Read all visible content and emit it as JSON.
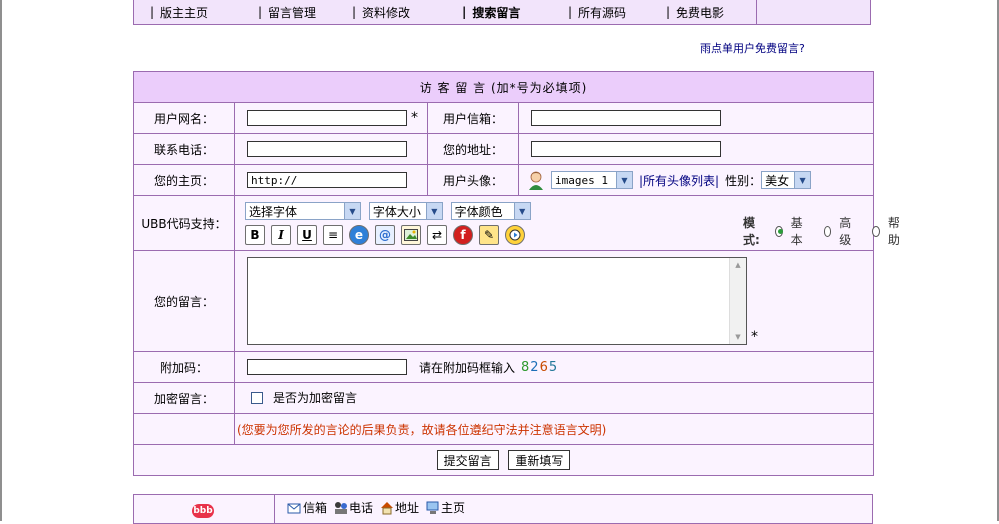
{
  "nav": {
    "items": [
      {
        "label": "版主主页",
        "bold": false
      },
      {
        "label": "留言管理",
        "bold": false
      },
      {
        "label": "资料修改",
        "bold": false
      },
      {
        "label": "搜索留言",
        "bold": true
      },
      {
        "label": "所有源码",
        "bold": false
      },
      {
        "label": "免费电影",
        "bold": false
      }
    ],
    "separator": "|"
  },
  "free_link": "雨点单用户免费留言?",
  "form": {
    "header": "访 客 留 言 (加*号为必填项)",
    "username_label": "用户网名：",
    "email_label": "用户信箱：",
    "phone_label": "联系电话：",
    "address_label": "您的地址：",
    "homepage_label": "您的主页：",
    "homepage_value": "http://",
    "avatar_label": "用户头像：",
    "avatar_select": "images 1",
    "avatar_list_link": "|所有头像列表|",
    "gender_label": "性别：",
    "gender_value": "美女",
    "ubb_label": "UBB代码支持：",
    "font_select": "选择字体",
    "size_select": "字体大小",
    "color_select": "字体颜色",
    "mode_label": "模式:",
    "mode_options": [
      "基本",
      "高级",
      "帮助"
    ],
    "message_label": "您的留言：",
    "required_mark": "*",
    "code_label": "附加码：",
    "code_hint": "请在附加码框输入",
    "code_digits": [
      "8",
      "2",
      "6",
      "5"
    ],
    "encrypt_label": "加密留言：",
    "encrypt_checkbox_label": "是否为加密留言",
    "notice": "(您要为您所发的言论的后果负责，故请各位遵纪守法并注意语言文明)",
    "submit": "提交留言",
    "reset": "重新填写"
  },
  "bottom": {
    "logo_text": "bbb",
    "links": [
      "信箱",
      "电话",
      "地址",
      "主页"
    ]
  },
  "colors": {
    "border": "#9b6bb0",
    "header_bg": "#ebcdfb",
    "cell_bg": "#fbf3ff",
    "notice": "#cc3300",
    "code_digit_colors": [
      "#2f9a2f",
      "#1d6fb8",
      "#c84b00",
      "#227799"
    ]
  }
}
